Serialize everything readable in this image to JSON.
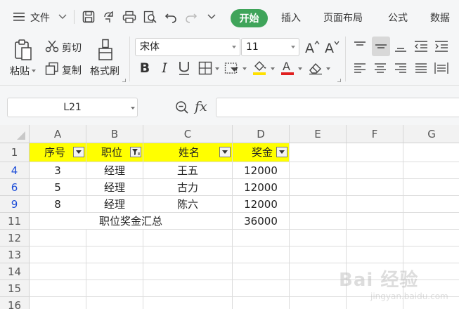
{
  "menubar": {
    "file_label": "文件",
    "tabs": [
      "开始",
      "插入",
      "页面布局",
      "公式",
      "数据"
    ]
  },
  "ribbon": {
    "paste_label": "粘贴",
    "cut_label": "剪切",
    "copy_label": "复制",
    "format_painter_label": "格式刷",
    "font_name": "宋体",
    "font_size": "11"
  },
  "formula_bar": {
    "name_box": "L21",
    "fx_label": "fx",
    "formula": ""
  },
  "sheet": {
    "columns": [
      "A",
      "B",
      "C",
      "D",
      "E",
      "F",
      "G"
    ],
    "rows": [
      {
        "num": "1",
        "cells": [
          "序号",
          "职位",
          "姓名",
          "奖金"
        ]
      },
      {
        "num": "4",
        "cells": [
          "3",
          "经理",
          "王五",
          "12000"
        ]
      },
      {
        "num": "6",
        "cells": [
          "5",
          "经理",
          "古力",
          "12000"
        ]
      },
      {
        "num": "9",
        "cells": [
          "8",
          "经理",
          "陈六",
          "12000"
        ]
      },
      {
        "num": "11",
        "cells": [
          "职位奖金汇总",
          "36000"
        ]
      },
      {
        "num": "12",
        "cells": []
      },
      {
        "num": "13",
        "cells": []
      },
      {
        "num": "14",
        "cells": []
      },
      {
        "num": "15",
        "cells": []
      },
      {
        "num": "16",
        "cells": []
      }
    ]
  },
  "watermark": {
    "text_main": "Bai 经验",
    "text_sub": "jingyan.baidu.com"
  },
  "colors": {
    "accent_green": "#3fa45a",
    "header_highlight": "#ffff00",
    "filtered_row_number": "#1f4fd8"
  }
}
